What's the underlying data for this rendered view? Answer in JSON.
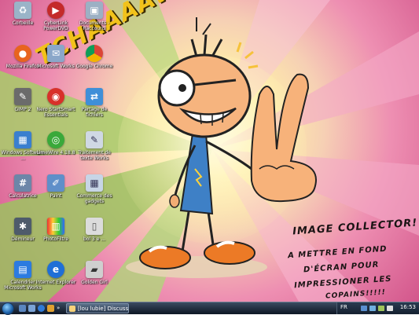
{
  "desktop": {
    "icons_col1": [
      {
        "label": "Corbeille",
        "icon": "recycle-bin-icon",
        "color": "#9ab4c8"
      },
      {
        "label": "Mozilla Firefox",
        "icon": "firefox-icon",
        "color": "#e8641e"
      },
      {
        "label": "GIMP 2",
        "icon": "gimp-icon",
        "color": "#6b6b6b"
      },
      {
        "label": "Windows Software ...",
        "icon": "windows-software-icon",
        "color": "#3a7fcf"
      },
      {
        "label": "Calculatrice",
        "icon": "calculator-icon",
        "color": "#6d86a8"
      },
      {
        "label": "Démineur",
        "icon": "minesweeper-icon",
        "color": "#4e5b6b"
      },
      {
        "label": "Calendrier Microsoft Works",
        "icon": "calendar-icon",
        "color": "#2c7be0"
      }
    ],
    "icons_col2": [
      {
        "label": "CyberLink PowerDVD",
        "icon": "powerdvd-icon",
        "color": "#c42a2a"
      },
      {
        "label": "Microsoft Works",
        "icon": "works-icon",
        "color": "#8aa7c9"
      },
      {
        "label": "Nero StartSmart Essentials",
        "icon": "nero-icon",
        "color": "#d8302a"
      },
      {
        "label": "LimeWire 4.18.8",
        "icon": "limewire-icon",
        "color": "#3aa93a"
      },
      {
        "label": "Paint",
        "icon": "paint-icon",
        "color": "#5f8fc9"
      },
      {
        "label": "PhotoFiltre",
        "icon": "photofiltre-icon",
        "color": "#d94b20"
      },
      {
        "label": "Internet Explorer",
        "icon": "internet-explorer-icon",
        "color": "#1f6fd6"
      }
    ],
    "icons_col3": [
      {
        "label": "Documents - Raccourci",
        "icon": "documents-icon",
        "color": "#9cb0c4"
      },
      {
        "label": "Google Chrome",
        "icon": "chrome-icon",
        "color": "#2e9a3d"
      },
      {
        "label": "Partage de fichiers",
        "icon": "sharing-icon",
        "color": "#3f8fd8"
      },
      {
        "label": "Traitement de texte Works",
        "icon": "word-processor-icon",
        "color": "#cfd8e4"
      },
      {
        "label": "Commerce des gadgets",
        "icon": "gadgets-icon",
        "color": "#c7d5e6"
      },
      {
        "label": "bol 3 e ...",
        "icon": "document-icon",
        "color": "#dcdcdc"
      },
      {
        "label": "Golden Girl",
        "icon": "golden-girl-icon",
        "color": "#cfcfcf"
      }
    ],
    "wallpaper": {
      "shout": "TCHAAAAW!",
      "line1": "IMAGE COLLECTOR!",
      "line2": "A METTRE EN FOND",
      "line3": "D'ÉCRAN POUR",
      "line4": "IMPRESSIONER LES",
      "line5": "COPAINS!!!!!"
    }
  },
  "taskbar": {
    "task_label": "[lou lubie] Discussio...",
    "lang": "FR",
    "clock": "16:53",
    "tray_colors": [
      "#5a8fd0",
      "#70b0e0",
      "#9fc45a",
      "#e0e0e0"
    ]
  }
}
